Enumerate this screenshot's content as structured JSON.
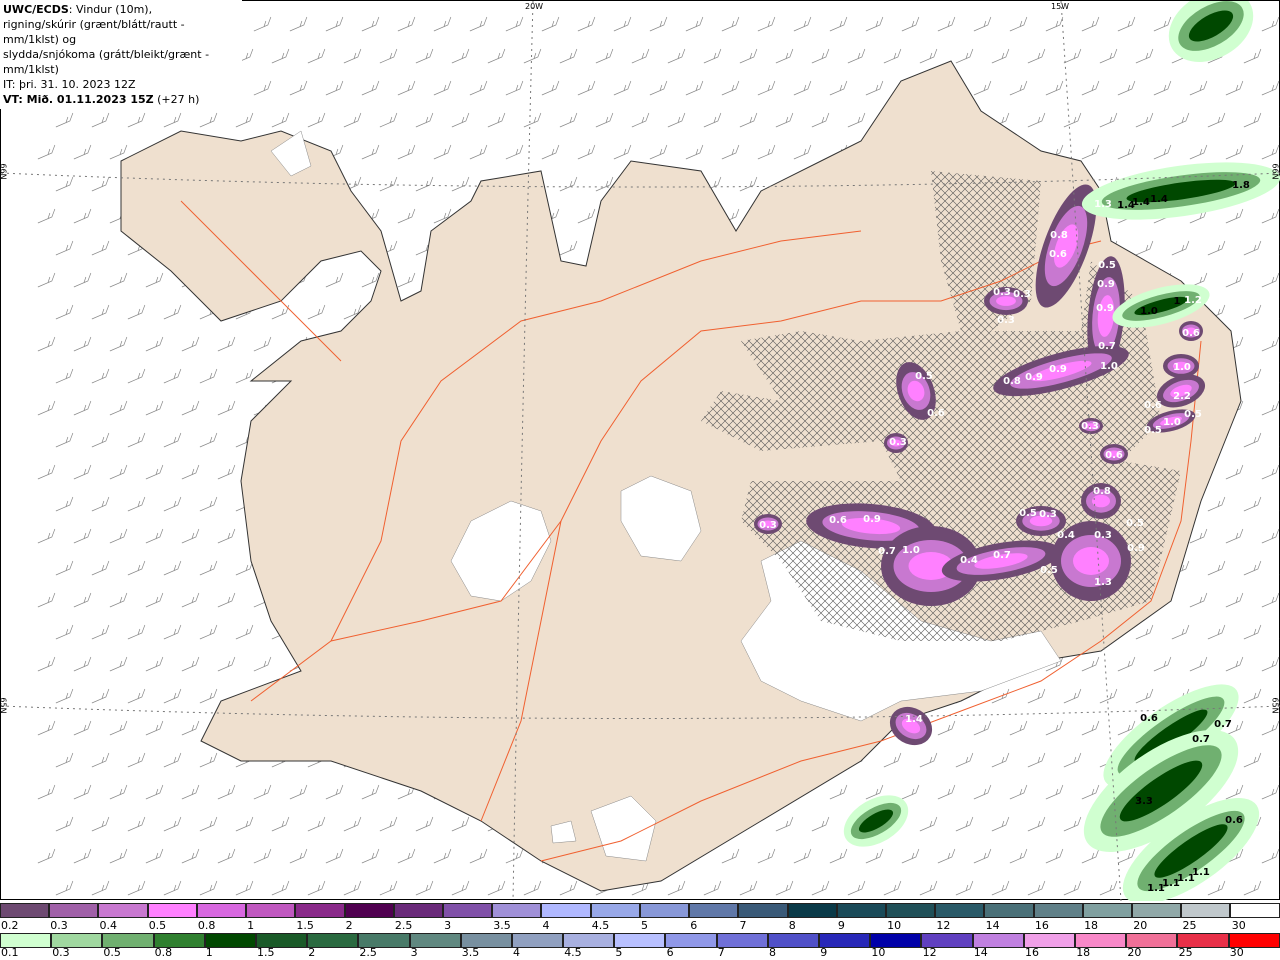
{
  "header": {
    "model": "UWC/ECDS",
    "line1": ": Vindur (10m),",
    "line2": "rigning/skúrir (grænt/blátt/rautt - mm/1klst) og",
    "line3": "slydda/snjókoma (grátt/bleikt/grænt - mm/1klst)",
    "issue_time": "IT: þri. 31. 10. 2023 12Z",
    "valid_time": "VT: Mið. 01.11.2023 15Z",
    "lead": "(+27 h)"
  },
  "grid_labels": {
    "lon1": "20W",
    "lon2": "15W",
    "lat1": "66N",
    "lat2": "65N"
  },
  "colors": {
    "land": "#efe0cf",
    "coast": "#333333",
    "roads": "#f06030",
    "hatch": "#555555"
  },
  "snow_labels": [
    "1.3",
    "0.8",
    "0.6",
    "0.3",
    "0.3",
    "0.3",
    "0.5",
    "0.9",
    "0.9",
    "0.7",
    "1.0",
    "0.8",
    "0.9",
    "0.9",
    "1.2",
    "0.6",
    "1.0",
    "2.2",
    "0.6",
    "0.5",
    "1.0",
    "0.5",
    "0.6",
    "0.5",
    "0.6",
    "0.3",
    "0.3",
    "0.3",
    "0.6",
    "0.9",
    "0.7",
    "1.0",
    "0.4",
    "0.7",
    "0.5",
    "0.5",
    "0.3",
    "0.8",
    "0.4",
    "0.3",
    "0.5",
    "0.9",
    "1.3",
    "1.4"
  ],
  "rain_labels": [
    "1.4",
    "1.4",
    "1.4",
    "1.8",
    "1.0",
    "1",
    "0.6",
    "0.7",
    "0.7",
    "3.3",
    "0.6",
    "1.1",
    "1.1",
    "1.1",
    "1.1"
  ],
  "colorbar_snow": {
    "labels": [
      "0.2",
      "0.3",
      "0.4",
      "0.5",
      "0.8",
      "1",
      "1.5",
      "2",
      "2.5",
      "3",
      "3.5",
      "4",
      "4.5",
      "5",
      "6",
      "7",
      "8",
      "9",
      "10",
      "12",
      "14",
      "16",
      "18",
      "20",
      "25",
      "30"
    ],
    "colors": [
      "#6e4a72",
      "#a060a8",
      "#c878d0",
      "#ff80ff",
      "#d868e0",
      "#c058c0",
      "#8a2a8a",
      "#500050",
      "#6a2a7a",
      "#8050a8",
      "#a090d8",
      "#b0b8ff",
      "#98a8e8",
      "#8898d8",
      "#6078a8",
      "#3a5a78",
      "#0a3a48",
      "#1a4a58",
      "#205058",
      "#2a5a68",
      "#4a7078",
      "#608088",
      "#80a0a0",
      "#90a8a8",
      "#c0c8cc",
      "#ffffff"
    ]
  },
  "colorbar_rain": {
    "labels": [
      "0.1",
      "0.3",
      "0.5",
      "0.8",
      "1",
      "1.5",
      "2",
      "2.5",
      "3",
      "3.5",
      "4",
      "4.5",
      "5",
      "6",
      "7",
      "8",
      "9",
      "10",
      "12",
      "14",
      "16",
      "18",
      "20",
      "25",
      "30"
    ],
    "colors": [
      "#d0ffd0",
      "#a0d8a0",
      "#70b070",
      "#308030",
      "#004800",
      "#1a5a28",
      "#2a6a40",
      "#487a68",
      "#608880",
      "#7890a0",
      "#90a0c0",
      "#a8b0e0",
      "#b8c0ff",
      "#9098e8",
      "#7070d8",
      "#5050c8",
      "#2828b8",
      "#0000a8",
      "#6040c0",
      "#c080e0",
      "#f0a0e8",
      "#f888c8",
      "#f07098",
      "#e83048",
      "#ff0000"
    ]
  }
}
